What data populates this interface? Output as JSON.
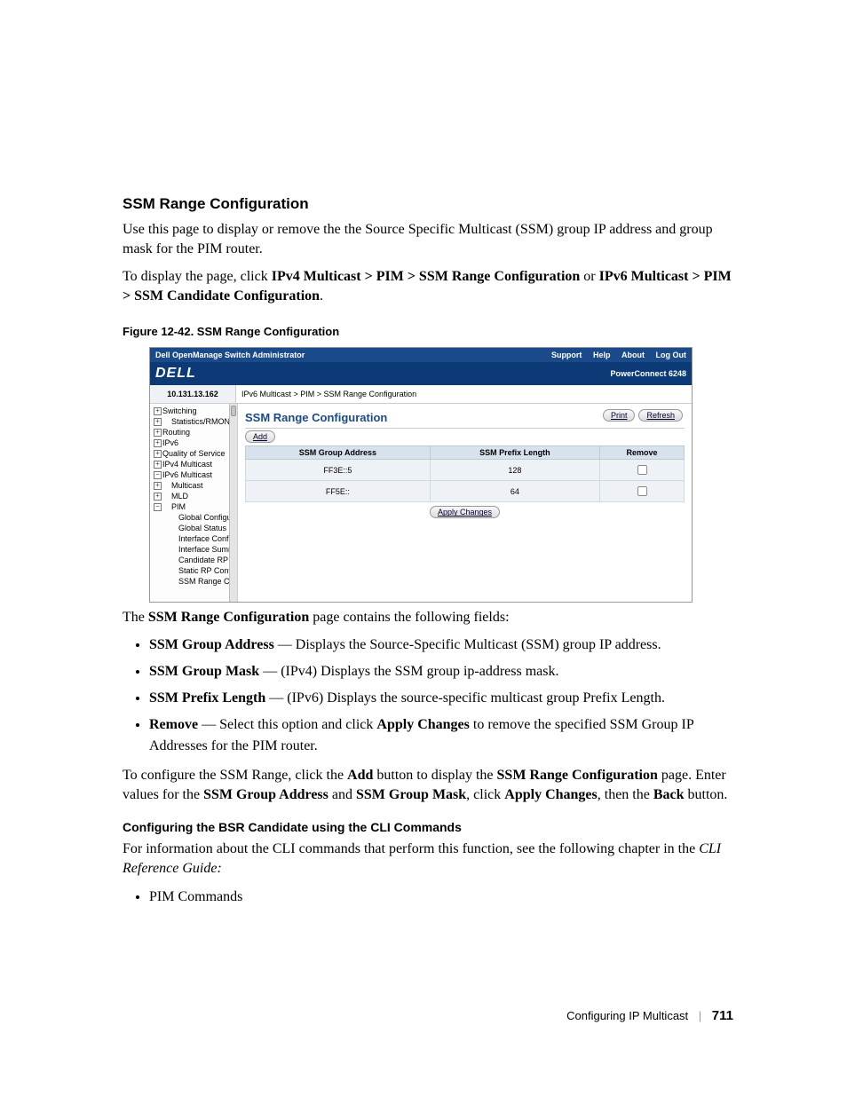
{
  "section_title": "SSM Range Configuration",
  "para1": "Use this page to display or remove the the Source Specific Multicast (SSM) group IP address and group mask for the PIM router.",
  "para2_pre": "To display the page, click ",
  "para2_nav1": "IPv4 Multicast > PIM > SSM Range Configuration",
  "para2_mid": " or ",
  "para2_nav2": "IPv6 Multicast > PIM > SSM Candidate Configuration",
  "para2_post": ".",
  "fig_caption": "Figure 12-42.    SSM Range Configuration",
  "shot": {
    "topbar_left": "Dell OpenManage Switch Administrator",
    "topbar_links": [
      "Support",
      "Help",
      "About",
      "Log Out"
    ],
    "logo": "DELL",
    "model": "PowerConnect 6248",
    "ip": "10.131.13.162",
    "breadcrumb": "IPv6 Multicast > PIM > SSM Range Configuration",
    "nav": [
      {
        "class": "top",
        "pm": "+",
        "label": "Switching"
      },
      {
        "class": "sub",
        "pm": "+",
        "label": "Statistics/RMON"
      },
      {
        "class": "top",
        "pm": "+",
        "label": "Routing"
      },
      {
        "class": "top",
        "pm": "+",
        "label": "IPv6"
      },
      {
        "class": "top",
        "pm": "+",
        "label": "Quality of Service"
      },
      {
        "class": "top",
        "pm": "+",
        "label": "IPv4 Multicast"
      },
      {
        "class": "top",
        "pm": "−",
        "label": "IPv6 Multicast"
      },
      {
        "class": "sub",
        "pm": "+",
        "label": "Multicast"
      },
      {
        "class": "sub",
        "pm": "+",
        "label": "MLD"
      },
      {
        "class": "sub",
        "pm": "−",
        "label": "PIM"
      },
      {
        "class": "sub2",
        "label": "Global Configurat"
      },
      {
        "class": "sub2",
        "label": "Global Status"
      },
      {
        "class": "sub2",
        "label": "Interface Configu"
      },
      {
        "class": "sub2",
        "label": "Interface Summa"
      },
      {
        "class": "sub2",
        "label": "Candidate RP Co"
      },
      {
        "class": "sub2",
        "label": "Static RP Config"
      },
      {
        "class": "sub2",
        "label": "SSM Range Con"
      }
    ],
    "content_title": "SSM Range Configuration",
    "btn_print": "Print",
    "btn_refresh": "Refresh",
    "btn_add": "Add",
    "btn_apply": "Apply Changes",
    "table": {
      "headers": [
        "SSM Group Address",
        "SSM Prefix Length",
        "Remove"
      ],
      "rows": [
        {
          "addr": "FF3E::5",
          "len": "128"
        },
        {
          "addr": "FF5E::",
          "len": "64"
        }
      ]
    }
  },
  "after_fig_pre": "The ",
  "after_fig_bold": "SSM Range Configuration",
  "after_fig_post": " page contains the following fields:",
  "fields": [
    {
      "name": "SSM Group Address",
      "desc": " — Displays the Source-Specific Multicast (SSM) group IP address."
    },
    {
      "name": "SSM Group Mask",
      "desc": " — (IPv4) Displays the SSM group ip-address mask."
    },
    {
      "name": "SSM Prefix Length",
      "desc": " — (IPv6) Displays the source-specific multicast group Prefix Length."
    }
  ],
  "field_remove": {
    "name": "Remove",
    "pre": " — Select this option and click ",
    "bold1": "Apply Changes",
    "post": " to remove the specified SSM Group IP Addresses for the PIM router."
  },
  "config_para": {
    "t1": "To configure the SSM Range, click the ",
    "b1": "Add",
    "t2": " button to display the ",
    "b2": "SSM Range Configuration",
    "t3": " page. Enter values for the ",
    "b3": "SSM Group Address",
    "t4": " and ",
    "b4": "SSM Group Mask",
    "t5": ", click ",
    "b5": "Apply Changes",
    "t6": ", then the ",
    "b6": "Back",
    "t7": " button."
  },
  "cli_title": "Configuring the BSR Candidate using the CLI Commands",
  "cli_para": "For information about the CLI commands that perform this function, see the following chapter in the ",
  "cli_ref": "CLI Reference Guide:",
  "cli_item": "PIM Commands",
  "footer_section": "Configuring IP Multicast",
  "footer_page": "711"
}
